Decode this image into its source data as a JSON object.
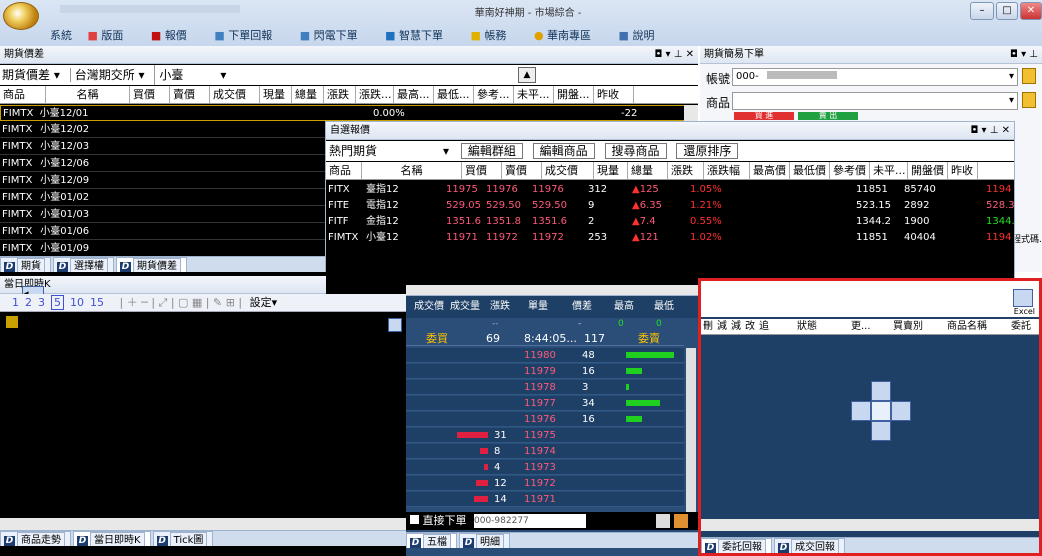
{
  "app": {
    "title": "華南好神期 - 市場綜合 -"
  },
  "menu": [
    "系統",
    "版面",
    "報價",
    "下單回報",
    "閃電下單",
    "智慧下單",
    "帳務",
    "華南專區",
    "說明"
  ],
  "futures_spread": {
    "panel_title": "期貨價差",
    "filter_type": "期貨價差",
    "filter_exchange": "台灣期交所",
    "filter_product": "小臺",
    "columns": [
      "商品",
      "名稱",
      "買價",
      "賣價",
      "成交價",
      "現量",
      "總量",
      "漲跌",
      "漲跌...",
      "最高...",
      "最低...",
      "參考...",
      "未平...",
      "開盤...",
      "昨收"
    ],
    "first_row": {
      "code": "FIMTX",
      "name": "小臺12/01",
      "pct": "0.00%",
      "chg": "-22"
    },
    "rows": [
      {
        "code": "FIMTX",
        "name": "小臺12/02"
      },
      {
        "code": "FIMTX",
        "name": "小臺12/03"
      },
      {
        "code": "FIMTX",
        "name": "小臺12/06"
      },
      {
        "code": "FIMTX",
        "name": "小臺12/09"
      },
      {
        "code": "FIMTX",
        "name": "小臺01/02"
      },
      {
        "code": "FIMTX",
        "name": "小臺01/03"
      },
      {
        "code": "FIMTX",
        "name": "小臺01/06"
      },
      {
        "code": "FIMTX",
        "name": "小臺01/09"
      }
    ],
    "tabs": [
      "期貨",
      "選擇權",
      "期貨價差"
    ]
  },
  "easy_order": {
    "panel_title": "期貨簡易下單",
    "account_label": "帳號",
    "account_value": "000-",
    "product_label": "商品",
    "buy_label": "買 進",
    "sell_label": "賣 出"
  },
  "watchlist": {
    "panel_title": "自選報價",
    "dropdown": "熱門期貨",
    "buttons": [
      "編輯群組",
      "編輯商品",
      "搜尋商品",
      "還原排序"
    ],
    "columns": [
      "商品",
      "名稱",
      "買價",
      "賣價",
      "成交價",
      "現量",
      "總量",
      "漲跌",
      "漲跌幅",
      "最高價",
      "最低價",
      "參考價",
      "未平...",
      "開盤價",
      "昨收"
    ],
    "rows": [
      {
        "code": "FITX",
        "name": "臺指12",
        "bid": "11975",
        "ask": "11976",
        "last": "11976",
        "vol": "312",
        "chg": "125",
        "pct": "1.05%",
        "ref": "11851",
        "oi": "85740",
        "prev": "1194"
      },
      {
        "code": "FITE",
        "name": "電指12",
        "bid": "529.05",
        "ask": "529.50",
        "last": "529.50",
        "vol": "9",
        "chg": "6.35",
        "pct": "1.21%",
        "ref": "523.15",
        "oi": "2892",
        "prev": "528.3"
      },
      {
        "code": "FITF",
        "name": "金指12",
        "bid": "1351.6",
        "ask": "1351.8",
        "last": "1351.6",
        "vol": "2",
        "chg": "7.4",
        "pct": "0.55%",
        "ref": "1344.2",
        "oi": "1900",
        "prev": "1344.("
      },
      {
        "code": "FIMTX",
        "name": "小臺12",
        "bid": "11971",
        "ask": "11972",
        "last": "11972",
        "vol": "253",
        "chg": "121",
        "pct": "1.02%",
        "ref": "11851",
        "oi": "40404",
        "prev": "1194"
      }
    ]
  },
  "intraday": {
    "panel_title": "當日即時K",
    "toolbar_nums": [
      "1",
      "2",
      "3",
      "5",
      "10",
      "15"
    ],
    "settings_label": "設定",
    "tabs": [
      "商品走勢",
      "當日即時K",
      "Tick圖"
    ]
  },
  "depth": {
    "columns": [
      "成交價",
      "成交量",
      "漲跌",
      "單量",
      "價差",
      "最高",
      "最低"
    ],
    "sub": {
      "dash": "--",
      "dash2": "-",
      "h": "0",
      "l": "0"
    },
    "header_row": {
      "commit_label": "委買",
      "qty": "69",
      "time": "8:44:05...",
      "n": "117",
      "sell_label": "委賣"
    },
    "rows": [
      {
        "price": "11980",
        "qty": "48",
        "bar": 0.8,
        "side": "ask"
      },
      {
        "price": "11979",
        "qty": "16",
        "bar": 0.27,
        "side": "ask"
      },
      {
        "price": "11978",
        "qty": "3",
        "bar": 0.05,
        "side": "ask"
      },
      {
        "price": "11977",
        "qty": "34",
        "bar": 0.57,
        "side": "ask"
      },
      {
        "price": "11976",
        "qty": "16",
        "bar": 0.27,
        "side": "ask"
      },
      {
        "price": "11975",
        "qty": "31",
        "bar": 0.52,
        "side": "bid"
      },
      {
        "price": "11974",
        "qty": "8",
        "bar": 0.13,
        "side": "bid"
      },
      {
        "price": "11973",
        "qty": "4",
        "bar": 0.07,
        "side": "bid"
      },
      {
        "price": "11972",
        "qty": "12",
        "bar": 0.2,
        "side": "bid"
      },
      {
        "price": "11971",
        "qty": "14",
        "bar": 0.23,
        "side": "bid"
      }
    ],
    "direct_order_label": "直接下單",
    "account_value": "000-982277",
    "tabs": [
      "五檔",
      "明細"
    ]
  },
  "order_report": {
    "columns": [
      "刪",
      "減",
      "減",
      "改",
      "追",
      "狀態",
      "更...",
      "買賣別",
      "商品名稱",
      "委託"
    ],
    "tabs": [
      "委託回報",
      "成交回報"
    ],
    "excel_label": "Excel",
    "side_label": "程式碼..."
  },
  "colors": {
    "up": "#ff3030",
    "ask_bar": "#20d020",
    "bid_bar": "#e02040",
    "highlight": "#e02020"
  }
}
